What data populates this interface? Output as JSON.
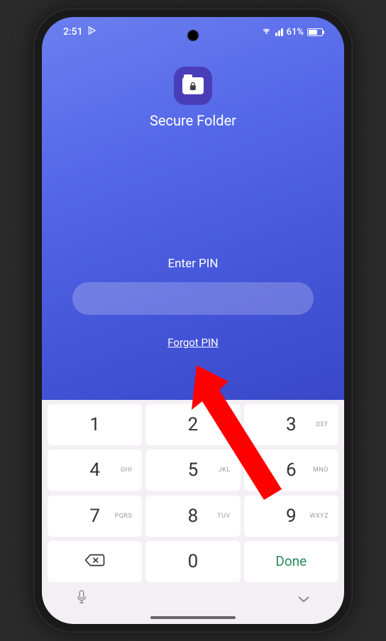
{
  "status": {
    "time": "2:51",
    "battery_pct": "61%"
  },
  "secure": {
    "title": "Secure Folder",
    "prompt": "Enter PIN",
    "forgot": "Forgot PIN"
  },
  "keypad": {
    "k1": {
      "d": "1",
      "l": ""
    },
    "k2": {
      "d": "2",
      "l": "ABC"
    },
    "k3": {
      "d": "3",
      "l": "DEF"
    },
    "k4": {
      "d": "4",
      "l": "GHI"
    },
    "k5": {
      "d": "5",
      "l": "JKL"
    },
    "k6": {
      "d": "6",
      "l": "MNO"
    },
    "k7": {
      "d": "7",
      "l": "PQRS"
    },
    "k8": {
      "d": "8",
      "l": "TUV"
    },
    "k9": {
      "d": "9",
      "l": "WXYZ"
    },
    "k0": {
      "d": "0",
      "l": ""
    },
    "done": "Done"
  }
}
